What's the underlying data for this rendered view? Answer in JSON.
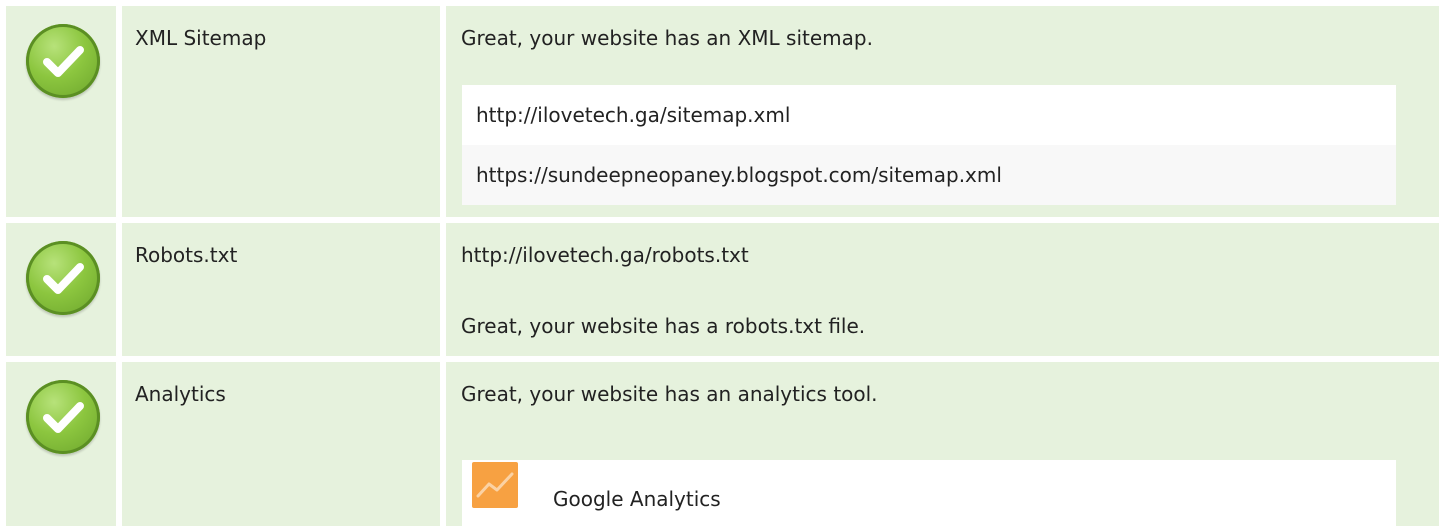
{
  "rows": [
    {
      "label": "XML Sitemap",
      "status_icon": "check-icon",
      "summary": "Great, your website has an XML sitemap.",
      "sitemaps": [
        "http://ilovetech.ga/sitemap.xml",
        "https://sundeepneopaney.blogspot.com/sitemap.xml"
      ]
    },
    {
      "label": "Robots.txt",
      "status_icon": "check-icon",
      "url": "http://ilovetech.ga/robots.txt",
      "summary": "Great, your website has a robots.txt file."
    },
    {
      "label": "Analytics",
      "status_icon": "check-icon",
      "summary": "Great, your website has an analytics tool.",
      "tool": {
        "name": "Google Analytics",
        "icon": "analytics-chart-icon"
      }
    }
  ],
  "colors": {
    "row_background": "#e6f2dd",
    "check_green": "#8cc63f",
    "analytics_orange": "#f7a142"
  }
}
